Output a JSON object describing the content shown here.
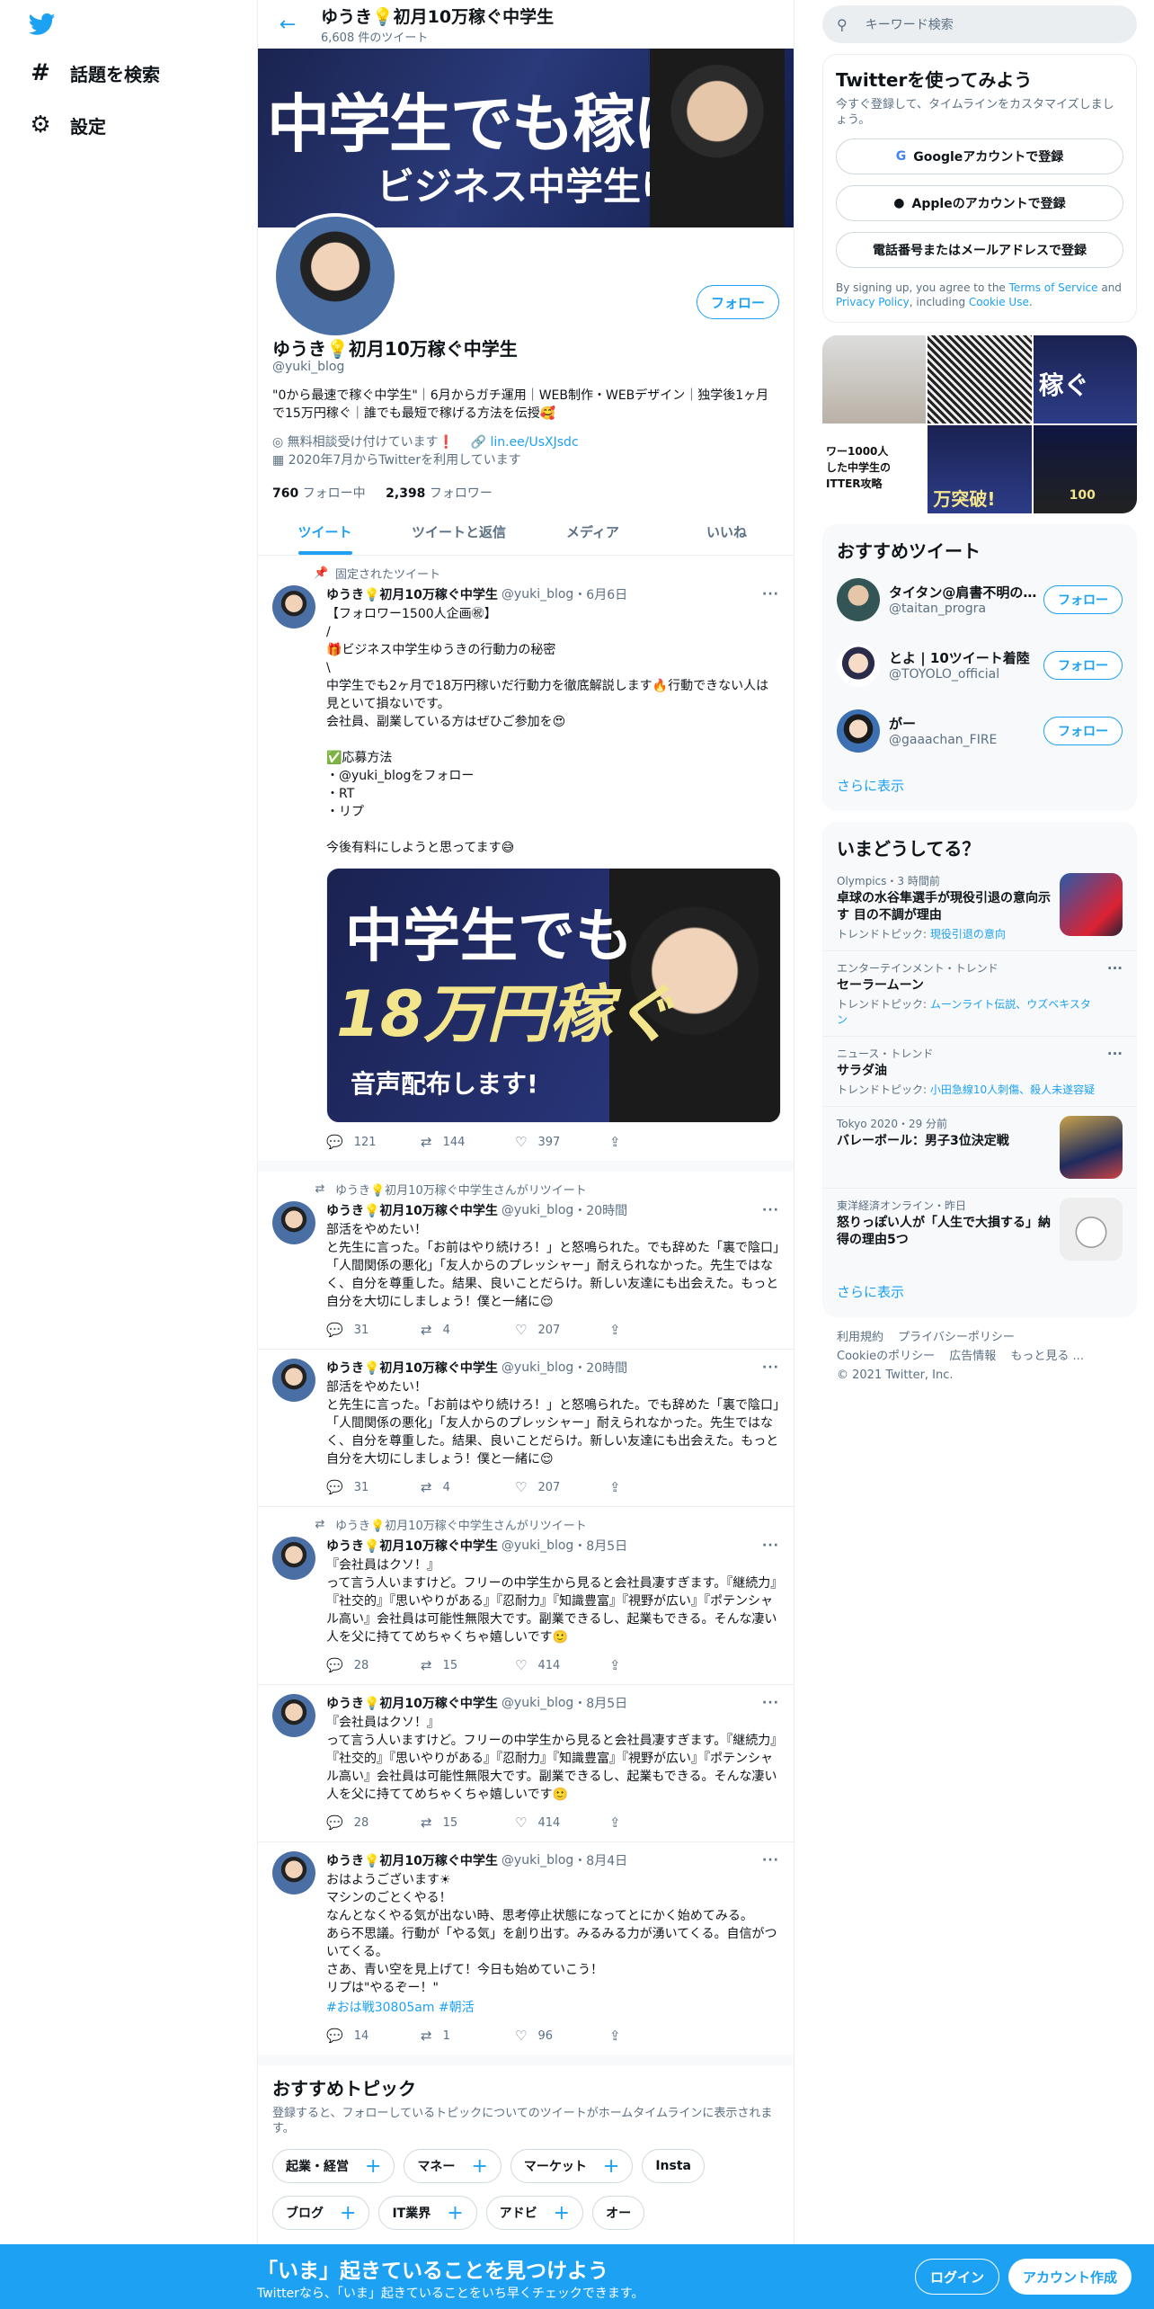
{
  "nav": {
    "items": [
      {
        "label": "話題を検索",
        "icon": "hashtag-icon"
      },
      {
        "label": "設定",
        "icon": "gear-icon"
      }
    ]
  },
  "header": {
    "name": "ゆうき💡初月10万稼ぐ中学生",
    "tweet_count": "6,608 件のツイート"
  },
  "banner": {
    "headline": "中学生でも稼げる!",
    "subline": "ビジネス中学生ゆうき"
  },
  "profile": {
    "follow_label": "フォロー",
    "name": "ゆうき💡初月10万稼ぐ中学生",
    "handle": "@yuki_blog",
    "bio": "\"0から最速で稼ぐ中学生\"｜6月からガチ運用｜WEB制作・WEBデザイン｜独学後1ヶ月で15万円稼ぐ｜誰でも最短で稼げる方法を伝授🥰",
    "location": "無料相談受け付けています❗",
    "link": "lin.ee/UsXJsdc",
    "joined": "2020年7月からTwitterを利用しています",
    "following_count": "760",
    "following_label": "フォロー中",
    "followers_count": "2,398",
    "followers_label": "フォロワー"
  },
  "tabs": [
    {
      "label": "ツイート",
      "active": true
    },
    {
      "label": "ツイートと返信",
      "active": false
    },
    {
      "label": "メディア",
      "active": false
    },
    {
      "label": "いいね",
      "active": false
    }
  ],
  "tweets": [
    {
      "context": "固定されたツイート",
      "name": "ゆうき💡初月10万稼ぐ中学生",
      "handle": "@yuki_blog",
      "time": "・6月6日",
      "text": "【フォロワー1500人企画㊗】\n/\n🎁ビジネス中学生ゆうきの行動力の秘密\n\\\n中学生でも2ヶ月で18万円稼いだ行動力を徹底解説します🔥行動できない人は見といて損ないです。\n会社員、副業している方はぜひご参加を😍\n\n✅応募方法\n・@yuki_blogをフォロー\n・RT\n・リプ\n\n今後有料にしようと思ってます😅",
      "media": {
        "l1": "中学生でも",
        "l2": "18万円稼ぐ",
        "l3": "音声配布します!"
      },
      "replies": "121",
      "retweets": "144",
      "likes": "397"
    },
    {
      "context": "ゆうき💡初月10万稼ぐ中学生さんがリツイート",
      "name": "ゆうき💡初月10万稼ぐ中学生",
      "handle": "@yuki_blog",
      "time": "・20時間",
      "text": "部活をやめたい！\nと先生に言った。「お前はやり続けろ！」と怒鳴られた。でも辞めた「裏で陰口」「人間関係の悪化」「友人からのプレッシャー」耐えられなかった。先生ではなく、自分を尊重した。結果、良いことだらけ。新しい友達にも出会えた。もっと自分を大切にしましょう！僕と一緒に😌",
      "replies": "31",
      "retweets": "4",
      "likes": "207"
    },
    {
      "context": "",
      "name": "ゆうき💡初月10万稼ぐ中学生",
      "handle": "@yuki_blog",
      "time": "・20時間",
      "text": "部活をやめたい！\nと先生に言った。「お前はやり続けろ！」と怒鳴られた。でも辞めた「裏で陰口」「人間関係の悪化」「友人からのプレッシャー」耐えられなかった。先生ではなく、自分を尊重した。結果、良いことだらけ。新しい友達にも出会えた。もっと自分を大切にしましょう！僕と一緒に😌",
      "replies": "31",
      "retweets": "4",
      "likes": "207"
    },
    {
      "context": "ゆうき💡初月10万稼ぐ中学生さんがリツイート",
      "name": "ゆうき💡初月10万稼ぐ中学生",
      "handle": "@yuki_blog",
      "time": "・8月5日",
      "text": "『会社員はクソ！』\nって言う人いますけど。フリーの中学生から見ると会社員凄すぎます。『継続力』『社交的』『思いやりがある』『忍耐力』『知識豊富』『視野が広い』『ポテンシャル高い』会社員は可能性無限大です。副業できるし、起業もできる。そんな凄い人を父に持ててめちゃくちゃ嬉しいです🙂",
      "replies": "28",
      "retweets": "15",
      "likes": "414"
    },
    {
      "context": "",
      "name": "ゆうき💡初月10万稼ぐ中学生",
      "handle": "@yuki_blog",
      "time": "・8月5日",
      "text": "『会社員はクソ！』\nって言う人いますけど。フリーの中学生から見ると会社員凄すぎます。『継続力』『社交的』『思いやりがある』『忍耐力』『知識豊富』『視野が広い』『ポテンシャル高い』会社員は可能性無限大です。副業できるし、起業もできる。そんな凄い人を父に持ててめちゃくちゃ嬉しいです🙂",
      "replies": "28",
      "retweets": "15",
      "likes": "414"
    },
    {
      "context": "",
      "name": "ゆうき💡初月10万稼ぐ中学生",
      "handle": "@yuki_blog",
      "time": "・8月4日",
      "text": "おはようございます☀\nマシンのごとくやる！\nなんとなくやる気が出ない時、思考停止状態になってとにかく始めてみる。\nあら不思議。行動が「やる気」を創り出す。みるみる力が湧いてくる。自信がついてくる。\nさあ、青い空を見上げて！今日も始めていこう！\nリプは\"やるぞー！\"",
      "hashtags": "#おは戦30805am #朝活",
      "replies": "14",
      "retweets": "1",
      "likes": "96"
    }
  ],
  "topics": {
    "title": "おすすめトピック",
    "desc": "登録すると、フォローしているトピックについてのツイートがホームタイムラインに表示されます。",
    "row1": [
      "起業・経営",
      "マネー",
      "マーケット",
      "Insta"
    ],
    "row2": [
      "ブログ",
      "IT業界",
      "アドビ",
      "オー"
    ]
  },
  "search": {
    "placeholder": "キーワード検索"
  },
  "signup": {
    "title": "Twitterを使ってみよう",
    "desc": "今すぐ登録して、タイムラインをカスタマイズしましょう。",
    "google": "Googleアカウントで登録",
    "apple": "Appleのアカウントで登録",
    "phone": "電話番号またはメールアドレスで登録",
    "legal_1": "By signing up, you agree to the ",
    "tos": "Terms of Service",
    "legal_2": " and ",
    "privacy": "Privacy Policy",
    "legal_3": ", including ",
    "cookie": "Cookie Use",
    "legal_4": "."
  },
  "photos": [
    "",
    "",
    "稼ぐ",
    "ワー1000人\nした中学生の\nITTER攻略",
    "万突破!",
    "100"
  ],
  "recommended": {
    "title": "おすすめツイート",
    "follow_label": "フォロー",
    "users": [
      {
        "name": "タイタン@肩書不明の…",
        "handle": "@taitan_progra"
      },
      {
        "name": "とよ | 10ツイート着陸",
        "handle": "@TOYOLO_official"
      },
      {
        "name": "がー",
        "handle": "@gaaachan_FIRE"
      }
    ],
    "more": "さらに表示"
  },
  "trends": {
    "title": "いまどうしてる？",
    "items": [
      {
        "meta": "Olympics・3 時間前",
        "title": "卓球の水谷隼選手が現役引退の意向示す 目の不調が理由",
        "sub_label": "トレンドトピック: ",
        "sub_link": "現役引退の意向",
        "thumb": true
      },
      {
        "meta": "エンターテインメント・トレンド",
        "title": "セーラームーン",
        "sub_label": "トレンドトピック: ",
        "sub_link": "ムーンライト伝説、ウズベキスタン",
        "thumb": false
      },
      {
        "meta": "ニュース・トレンド",
        "title": "サラダ油",
        "sub_label": "トレンドトピック: ",
        "sub_link": "小田急線10人刺傷、殺人未遂容疑",
        "thumb": false
      },
      {
        "meta": "Tokyo 2020・29 分前",
        "title": "バレーボール：男子3位決定戦",
        "sub_label": "",
        "sub_link": "",
        "thumb": true
      },
      {
        "meta": "東洋経済オンライン・昨日",
        "title": "怒りっぽい人が「人生で大損する」納得の理由5つ",
        "sub_label": "",
        "sub_link": "",
        "thumb": true
      }
    ],
    "more": "さらに表示"
  },
  "footer": {
    "links": [
      "利用規約",
      "プライバシーポリシー",
      "Cookieのポリシー",
      "広告情報",
      "もっと見る ..."
    ],
    "copyright": "© 2021 Twitter, Inc."
  },
  "bottombar": {
    "headline": "「いま」起きていることを見つけよう",
    "sub": "Twitterなら、「いま」起きていることをいち早くチェックできます。",
    "login": "ログイン",
    "signup": "アカウント作成"
  }
}
